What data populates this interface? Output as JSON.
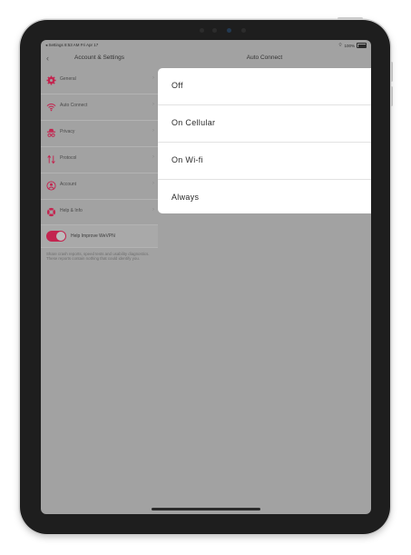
{
  "status_bar": {
    "left_text": "◂ Settings  8:53 AM  Fri Apr 17",
    "right_text": "100%"
  },
  "sidebar": {
    "title": "Account & Settings",
    "items": [
      {
        "label": "General",
        "icon": "gear-icon"
      },
      {
        "label": "Auto Connect",
        "icon": "wifi-icon"
      },
      {
        "label": "Privacy",
        "icon": "spy-icon"
      },
      {
        "label": "Protocol",
        "icon": "arrows-updown-icon"
      },
      {
        "label": "Account",
        "icon": "user-circle-icon"
      },
      {
        "label": "Help & Info",
        "icon": "lifebuoy-icon"
      }
    ],
    "toggle_label": "Help Improve WeVPN",
    "toggle_on": true,
    "note": "Share crash reports, speed tests and usability diagnostics. These reports contain nothing that could identify you."
  },
  "detail": {
    "title": "Auto Connect",
    "options": [
      "Off",
      "On Cellular",
      "On Wi-fi",
      "Always"
    ]
  },
  "colors": {
    "accent": "#c3244f",
    "dim_background": "#a2a2a2",
    "card": "#ffffff"
  }
}
